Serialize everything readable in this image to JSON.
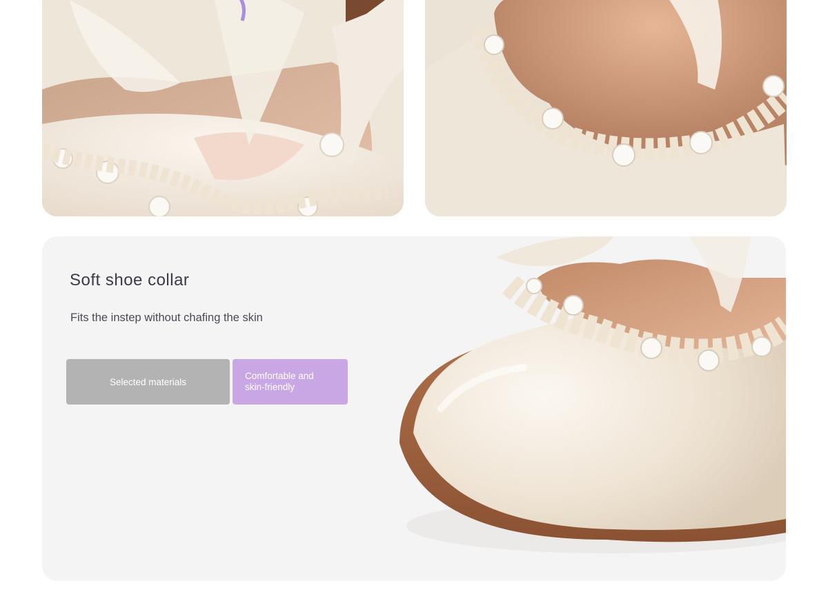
{
  "feature": {
    "title": "Soft shoe collar",
    "subtitle": "Fits the instep without chafing the skin",
    "tags": [
      {
        "label": "Selected materials"
      },
      {
        "label": "Comfortable and\nskin-friendly"
      }
    ]
  },
  "colors": {
    "panel_background": "#f4f4f5",
    "tag_gray": "#b3b3b3",
    "tag_purple": "#c8a7e4",
    "leather_ivory": "#efe4d4",
    "sole_brown": "#9a5c3a"
  },
  "images": [
    {
      "name": "shoe-detail-photo-1",
      "subject": "bow-and-pearl-lace-detail"
    },
    {
      "name": "shoe-detail-photo-2",
      "subject": "pearl-lace-collar-closeup"
    },
    {
      "name": "shoe-toe-photo",
      "subject": "round-toe-ivory-shoe"
    }
  ]
}
